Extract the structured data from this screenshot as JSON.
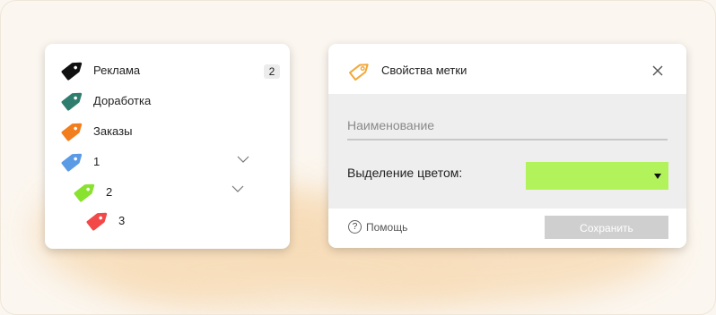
{
  "labels": [
    {
      "name": "Реклама",
      "color": "#111111",
      "count": "2",
      "expandable": false
    },
    {
      "name": "Доработка",
      "color": "#2f7d6e",
      "expandable": false
    },
    {
      "name": "Заказы",
      "color": "#f27d1c",
      "expandable": false
    },
    {
      "name": "1",
      "color": "#5b9be6",
      "expandable": true
    },
    {
      "name": "2",
      "color": "#89e22e",
      "expandable": true
    },
    {
      "name": "3",
      "color": "#f24848",
      "expandable": false
    }
  ],
  "icons": {
    "tag": "tag-icon",
    "expand": "chevron-down-icon",
    "close": "close-icon",
    "help": "help-circle-icon",
    "dropdown": "caret-down-icon"
  },
  "dialog": {
    "title": "Свойства метки",
    "title_icon_color": "#f2a83a",
    "name_placeholder": "Наименование",
    "name_value": "",
    "color_label": "Выделение цветом:",
    "selected_color": "#b2f25a",
    "help_label": "Помощь",
    "save_label": "Сохранить"
  }
}
